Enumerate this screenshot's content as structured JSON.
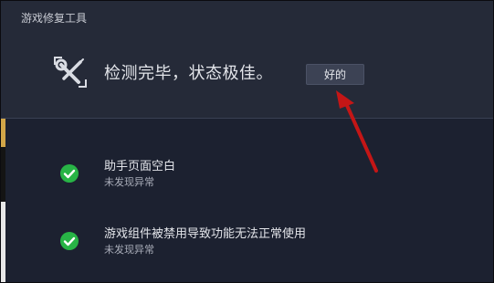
{
  "window": {
    "title": "游戏修复工具"
  },
  "status": {
    "icon": "wrench-screwdriver-icon",
    "message": "检测完毕，状态极佳。",
    "ok_label": "好的"
  },
  "annotation": {
    "arrow_icon": "red-arrow-icon",
    "arrow_color": "#c41616"
  },
  "results": [
    {
      "icon": "green-check-icon",
      "title": "助手页面空白",
      "subtitle": "未发现异常"
    },
    {
      "icon": "green-check-icon",
      "title": "游戏组件被禁用导致功能无法正常使用",
      "subtitle": "未发现异常"
    }
  ],
  "colors": {
    "header_bg": "#252a38",
    "body_bg": "#1c2130",
    "check_green": "#28b446"
  }
}
